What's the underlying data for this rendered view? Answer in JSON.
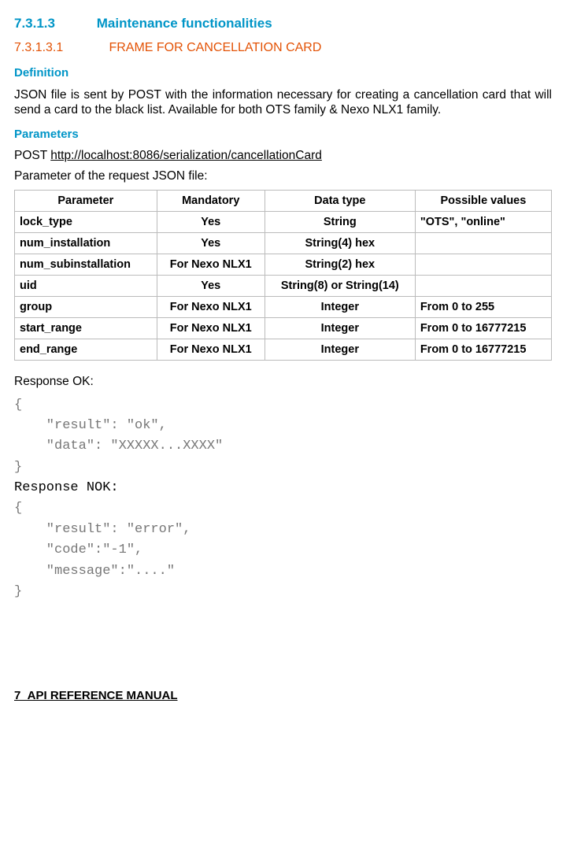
{
  "h3": {
    "num": "7.3.1.3",
    "title": "Maintenance functionalities"
  },
  "h4": {
    "num": "7.3.1.3.1",
    "title": "FRAME FOR CANCELLATION CARD"
  },
  "definition_head": "Definition",
  "definition_text": "JSON file is sent by POST with the information necessary for creating a cancellation card that will send a card to the black list. Available for both OTS family & Nexo NLX1 family.",
  "parameters_head": "Parameters",
  "post_label": "POST ",
  "post_url": "http://localhost:8086/serialization/cancellationCard",
  "param_request_label": "Parameter of the request JSON file:",
  "table": {
    "headers": [
      "Parameter",
      "Mandatory",
      "Data type",
      "Possible values"
    ],
    "rows": [
      [
        "lock_type",
        "Yes",
        "String",
        "\"OTS\", \"online\""
      ],
      [
        "num_installation",
        "Yes",
        "String(4) hex",
        ""
      ],
      [
        "num_subinstallation",
        "For Nexo NLX1",
        "String(2) hex",
        ""
      ],
      [
        "uid",
        "Yes",
        "String(8) or String(14)",
        ""
      ],
      [
        "group",
        "For Nexo NLX1",
        "Integer",
        "From 0 to 255"
      ],
      [
        "start_range",
        "For Nexo NLX1",
        "Integer",
        "From 0 to 16777215"
      ],
      [
        "end_range",
        "For Nexo NLX1",
        "Integer",
        "From 0 to 16777215"
      ]
    ]
  },
  "response_ok_label": "Response OK:",
  "code_ok": {
    "l1": "{",
    "l2": "    \"result\": \"ok\",",
    "l3": "    \"data\": \"XXXXX...XXXX\"",
    "l4": "}"
  },
  "response_nok_label": "Response NOK:",
  "code_nok": {
    "l1": "{",
    "l2": "    \"result\": \"error\",",
    "l3": "    \"code\":\"-1\",",
    "l4": "    \"message\":\"....\"",
    "l5": "}"
  },
  "footer": "7_API REFERENCE MANUAL"
}
